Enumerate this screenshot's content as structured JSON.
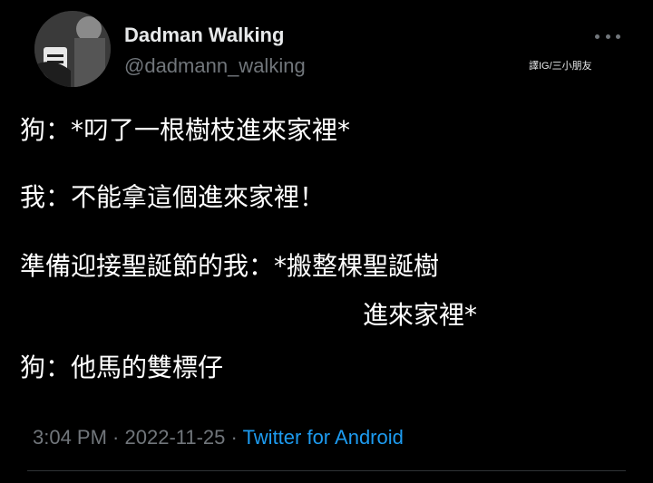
{
  "author": {
    "name": "Dadman Walking",
    "handle": "@dadmann_walking",
    "avatar_icon": "avatar-photo-icon"
  },
  "credit": "譯IG/三小朋友",
  "more_icon": "more-options-icon",
  "tweet": {
    "lines": [
      "狗：*叼了一根樹枝進來家裡*",
      "我：不能拿這個進來家裡！",
      "準備迎接聖誕節的我：*搬整棵聖誕樹",
      "進來家裡*",
      "狗：他馬的雙標仔"
    ]
  },
  "meta": {
    "time": "3:04 PM",
    "separator1": " · ",
    "date": "2022-11-25",
    "separator2": " · ",
    "source": "Twitter for Android"
  },
  "colors": {
    "background": "#000000",
    "text": "#e7e9ea",
    "muted": "#71767b",
    "link": "#1d9bf0",
    "divider": "#2f3336"
  }
}
